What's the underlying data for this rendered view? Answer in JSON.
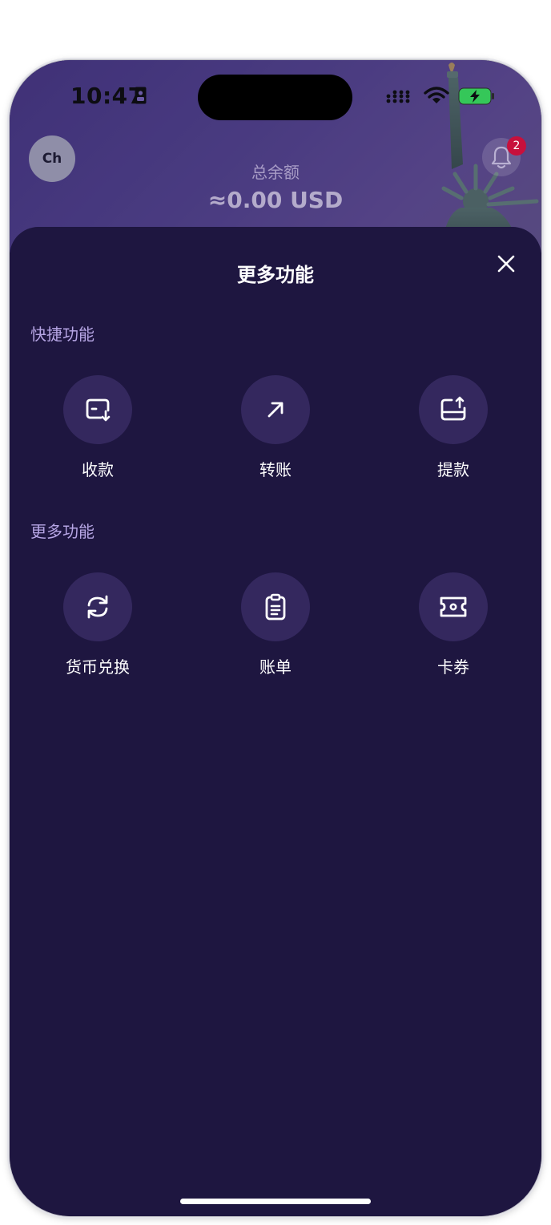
{
  "status_bar": {
    "time": "10:47",
    "icons": [
      "sim-card-icon",
      "signal-icon",
      "wifi-icon",
      "battery-charging-icon"
    ]
  },
  "header": {
    "avatar_initials": "Ch",
    "balance_label": "总余额",
    "balance_value": "≈0.00 USD",
    "notification_count": "2"
  },
  "sheet": {
    "title": "更多功能",
    "sections": [
      {
        "label": "快捷功能",
        "items": [
          {
            "label": "收款",
            "icon": "receive-icon"
          },
          {
            "label": "转账",
            "icon": "transfer-arrow-icon"
          },
          {
            "label": "提款",
            "icon": "withdraw-icon"
          }
        ]
      },
      {
        "label": "更多功能",
        "items": [
          {
            "label": "货币兑换",
            "icon": "exchange-icon"
          },
          {
            "label": "账单",
            "icon": "bill-clipboard-icon"
          },
          {
            "label": "卡券",
            "icon": "ticket-icon"
          }
        ]
      }
    ]
  },
  "colors": {
    "sheet_background": "#1e1640",
    "tile_circle": "#34285e",
    "section_label": "#b6a5e4",
    "badge": "#c8103c"
  }
}
